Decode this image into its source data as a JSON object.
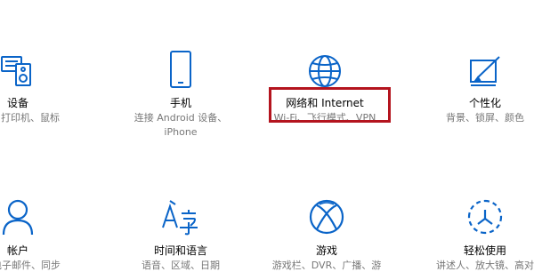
{
  "tiles": [
    {
      "id": "devices",
      "title": "设备",
      "desc": "、打印机、鼠标",
      "icon": "keyboard-speaker-icon"
    },
    {
      "id": "phone",
      "title": "手机",
      "desc": "连接 Android 设备、",
      "desc2": "iPhone",
      "icon": "phone-icon"
    },
    {
      "id": "network",
      "title": "网络和 Internet",
      "desc": "Wi-Fi、飞行模式、VPN",
      "icon": "globe-icon"
    },
    {
      "id": "personalization",
      "title": "个性化",
      "desc": "背景、锁屏、颜色",
      "icon": "paint-brush-icon"
    },
    {
      "id": "accounts",
      "title": "帐户",
      "desc": "、电子邮件、同步",
      "icon": "person-icon"
    },
    {
      "id": "time",
      "title": "时间和语言",
      "desc": "语音、区域、日期",
      "icon": "language-icon"
    },
    {
      "id": "gaming",
      "title": "游戏",
      "desc": "游戏栏、DVR、广播、游",
      "icon": "xbox-icon"
    },
    {
      "id": "ease",
      "title": "轻松使用",
      "desc": "讲述人、放大镜、高对",
      "icon": "ease-of-access-icon"
    }
  ],
  "accent_color": "#0a64c8",
  "highlight_color": "#b4141e"
}
